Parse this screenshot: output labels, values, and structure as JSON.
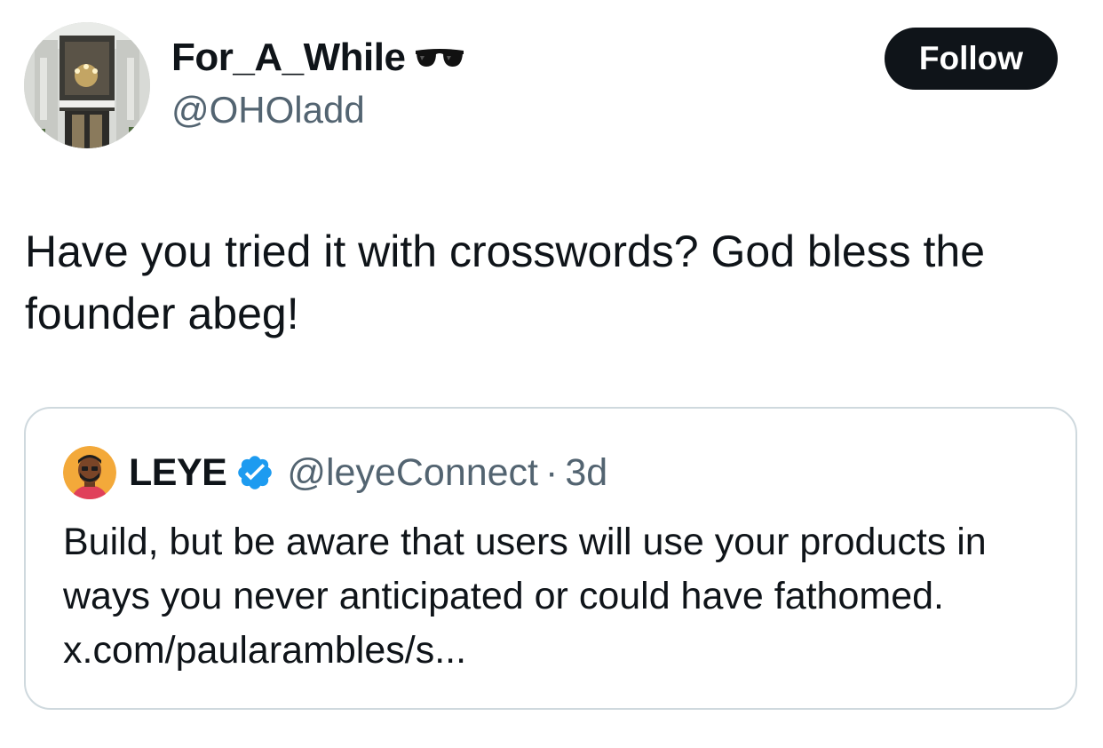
{
  "author": {
    "display_name": "For_A_While",
    "name_emoji_icon": "sunglasses-icon",
    "handle": "@OHOladd"
  },
  "follow_label": "Follow",
  "tweet_text": "Have you tried it with crosswords? God bless the founder abeg!",
  "quoted": {
    "name": "LEYE",
    "verified_icon": "verified-badge-icon",
    "handle": "@leyeConnect",
    "separator": "·",
    "time": "3d",
    "text": "Build, but be aware that users will use your products in ways you never anticipated or could have fathomed. x.com/paularambles/s..."
  },
  "colors": {
    "text_primary": "#0f1419",
    "text_secondary": "#536471",
    "follow_bg": "#0f1419",
    "card_border": "#cfd9de",
    "verified_blue": "#1d9bf0"
  }
}
